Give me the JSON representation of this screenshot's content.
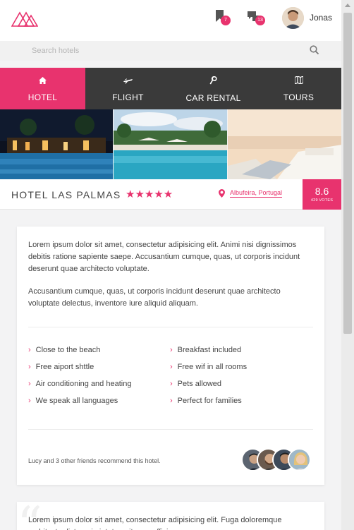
{
  "header": {
    "bookmark_count": "7",
    "messages_count": "13",
    "username": "Jonas"
  },
  "search": {
    "placeholder": "Search hotels"
  },
  "nav": {
    "tabs": [
      {
        "label": "HOTEL",
        "icon": "home-icon",
        "active": true
      },
      {
        "label": "FLIGHT",
        "icon": "airplane-icon",
        "active": false
      },
      {
        "label": "CAR RENTAL",
        "icon": "wrench-icon",
        "active": false
      },
      {
        "label": "TOURS",
        "icon": "map-icon",
        "active": false
      }
    ]
  },
  "hotel": {
    "name": "HOTEL LAS PALMAS",
    "stars": "★★★★★",
    "location": "Albufeira, Portugal",
    "score": "8.6",
    "votes": "429 VOTES"
  },
  "description": {
    "p1": "Lorem ipsum dolor sit amet, consectetur adipisicing elit. Animi nisi dignissimos debitis ratione sapiente saepe. Accusantium cumque, quas, ut corporis incidunt deserunt quae architecto voluptate.",
    "p2": "Accusantium cumque, quas, ut corporis incidunt deserunt quae architecto voluptate delectus, inventore iure aliquid aliquam."
  },
  "features": {
    "left": [
      "Close to the beach",
      "Free aiport shttle",
      "Air conditioning and heating",
      "We speak all languages"
    ],
    "right": [
      "Breakfast included",
      "Free wif in all rooms",
      "Pets allowed",
      "Perfect for families"
    ]
  },
  "recommend": "Lucy and 3 other friends recommend this hotel.",
  "review": {
    "text": "Lorem ipsum dolor sit amet, consectetur adipisicing elit. Fuga doloremque architecto dicta animi, totam, itaque officia"
  },
  "colors": {
    "accent": "#e8336e",
    "nav_bg": "#3a3a3a"
  }
}
